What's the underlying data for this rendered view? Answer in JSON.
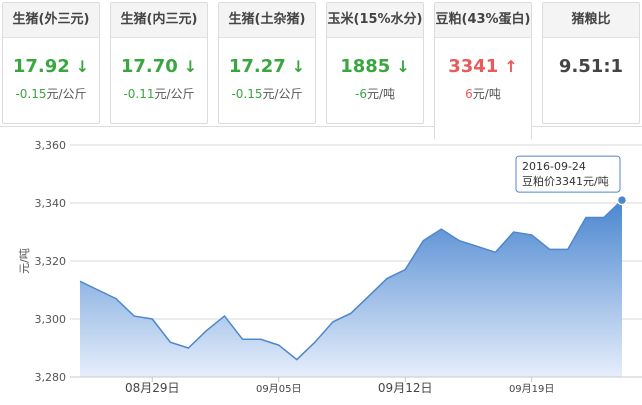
{
  "cards": [
    {
      "title": "生猪(外三元)",
      "price": "17.92",
      "direction": "down",
      "change": "-0.15",
      "unit": "元/公斤"
    },
    {
      "title": "生猪(内三元)",
      "price": "17.70",
      "direction": "down",
      "change": "-0.11",
      "unit": "元/公斤"
    },
    {
      "title": "生猪(土杂猪)",
      "price": "17.27",
      "direction": "down",
      "change": "-0.15",
      "unit": "元/公斤"
    },
    {
      "title": "玉米(15%水分)",
      "price": "1885",
      "direction": "down",
      "change": "-6",
      "unit": "元/吨"
    },
    {
      "title": "豆粕(43%蛋白)",
      "price": "3341",
      "direction": "up",
      "change": "6",
      "unit": "元/吨"
    },
    {
      "title": "猪粮比",
      "price": "9.51:1",
      "direction": "none",
      "change": "",
      "unit": ""
    }
  ],
  "icons": {
    "down": "arrow-down-icon",
    "up": "arrow-up-icon"
  },
  "colors": {
    "down": "#3aa640",
    "up": "#e95b5b",
    "area_top": "#4a86d0",
    "area_bottom": "#e6eefb",
    "line": "#4f87cc"
  },
  "chart_data": {
    "type": "area",
    "ylabel": "元/吨",
    "ylim": [
      3280,
      3360
    ],
    "yticks": [
      3280,
      3300,
      3320,
      3340,
      3360
    ],
    "ytick_labels": [
      "3,280",
      "3,300",
      "3,320",
      "3,340",
      "3,360"
    ],
    "xticks": [
      {
        "date": "2016-08-29",
        "label": "08月29日"
      },
      {
        "date": "2016-09-05",
        "label": "09月05日"
      },
      {
        "date": "2016-09-12",
        "label": "09月12日"
      },
      {
        "date": "2016-09-19",
        "label": "09月19日"
      }
    ],
    "x": [
      "2016-08-25",
      "2016-08-26",
      "2016-08-27",
      "2016-08-28",
      "2016-08-29",
      "2016-08-30",
      "2016-08-31",
      "2016-09-01",
      "2016-09-02",
      "2016-09-03",
      "2016-09-04",
      "2016-09-05",
      "2016-09-06",
      "2016-09-07",
      "2016-09-08",
      "2016-09-09",
      "2016-09-10",
      "2016-09-11",
      "2016-09-12",
      "2016-09-13",
      "2016-09-14",
      "2016-09-15",
      "2016-09-16",
      "2016-09-17",
      "2016-09-18",
      "2016-09-19",
      "2016-09-20",
      "2016-09-21",
      "2016-09-22",
      "2016-09-23",
      "2016-09-24"
    ],
    "series": [
      {
        "values": [
          3313,
          3310,
          3307,
          3301,
          3300,
          3292,
          3290,
          3296,
          3301,
          3293,
          3293,
          3291,
          3286,
          3292,
          3299,
          3302,
          3308,
          3314,
          3317,
          3327,
          3331,
          3327,
          3325,
          3323,
          3330,
          3329,
          3324,
          3324,
          3335,
          3335,
          3341
        ]
      }
    ],
    "tooltip": {
      "date": "2016-09-24",
      "label": "豆粕价3341元/吨"
    },
    "grid": true
  }
}
